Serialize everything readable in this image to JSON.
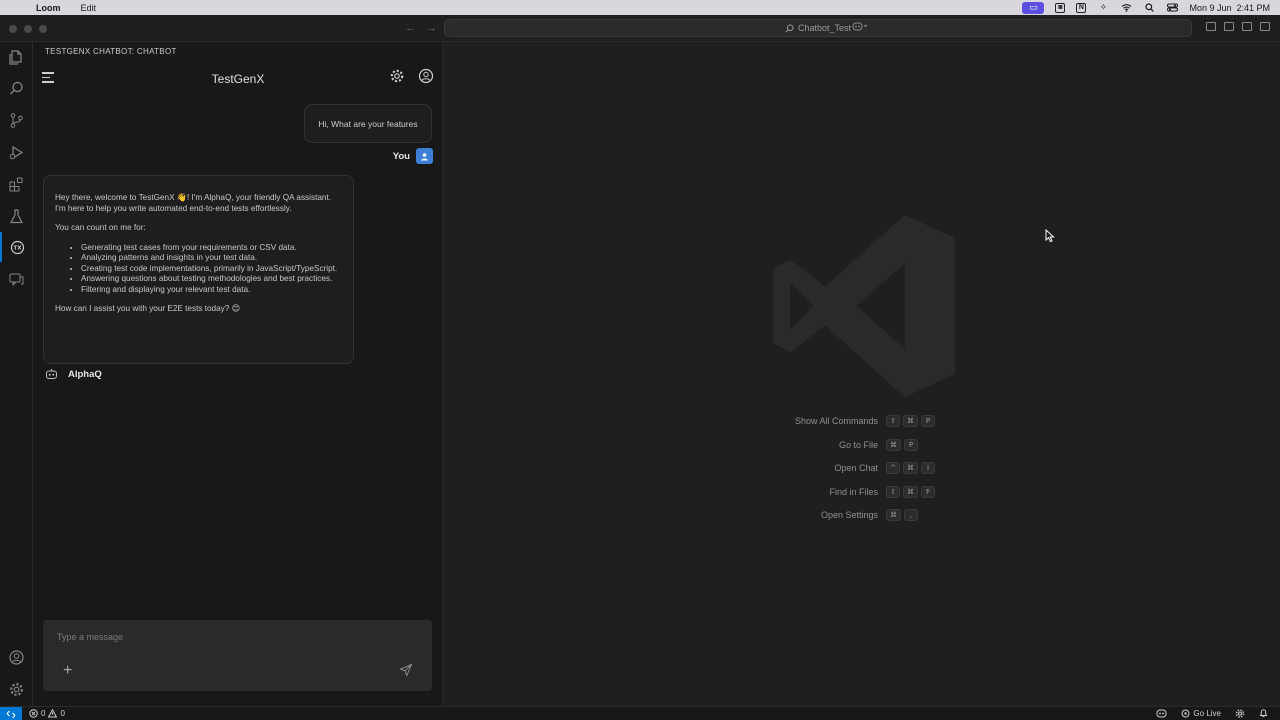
{
  "menubar": {
    "app_name": "Loom",
    "menu_edit": "Edit",
    "datetime": "Mon 9 Jun  2:41 PM",
    "notion_glyph": "N"
  },
  "titlebar": {
    "search_text": "Chatbot_Test"
  },
  "sidebar": {
    "title": "TESTGENX CHATBOT: CHATBOT",
    "chat_title": "TestGenX"
  },
  "messages": {
    "user_text": "Hi, What are your features",
    "user_name": "You",
    "bot_intro": "Hey there, welcome to TestGenX 👋! I'm AlphaQ, your friendly QA assistant. I'm here to help you write automated end-to-end tests effortlessly.",
    "bot_count_on": "You can count on me for:",
    "bot_features": [
      "Generating test cases from your requirements or CSV data.",
      "Analyzing patterns and insights in your test data.",
      "Creating test code implementations, primarily in JavaScript/TypeScript.",
      "Answering questions about testing methodologies and best practices.",
      "Filtering and displaying your relevant test data."
    ],
    "bot_closing": "How can I assist you with your E2E tests today? 😊",
    "bot_name": "AlphaQ"
  },
  "composer": {
    "placeholder": "Type a message",
    "plus": "+"
  },
  "shortcuts": [
    {
      "label": "Show All Commands",
      "keys": [
        "⇧",
        "⌘",
        "P"
      ]
    },
    {
      "label": "Go to File",
      "keys": [
        "⌘",
        "P"
      ]
    },
    {
      "label": "Open Chat",
      "keys": [
        "^",
        "⌘",
        "I"
      ]
    },
    {
      "label": "Find in Files",
      "keys": [
        "⇧",
        "⌘",
        "F"
      ]
    },
    {
      "label": "Open Settings",
      "keys": [
        "⌘",
        ","
      ]
    }
  ],
  "statusbar": {
    "errors": "0",
    "warnings": "0",
    "go_live": "Go Live"
  },
  "colors": {
    "accent": "#0078d4",
    "avatar": "#3d7fd6",
    "loom": "#5b4ee0"
  }
}
